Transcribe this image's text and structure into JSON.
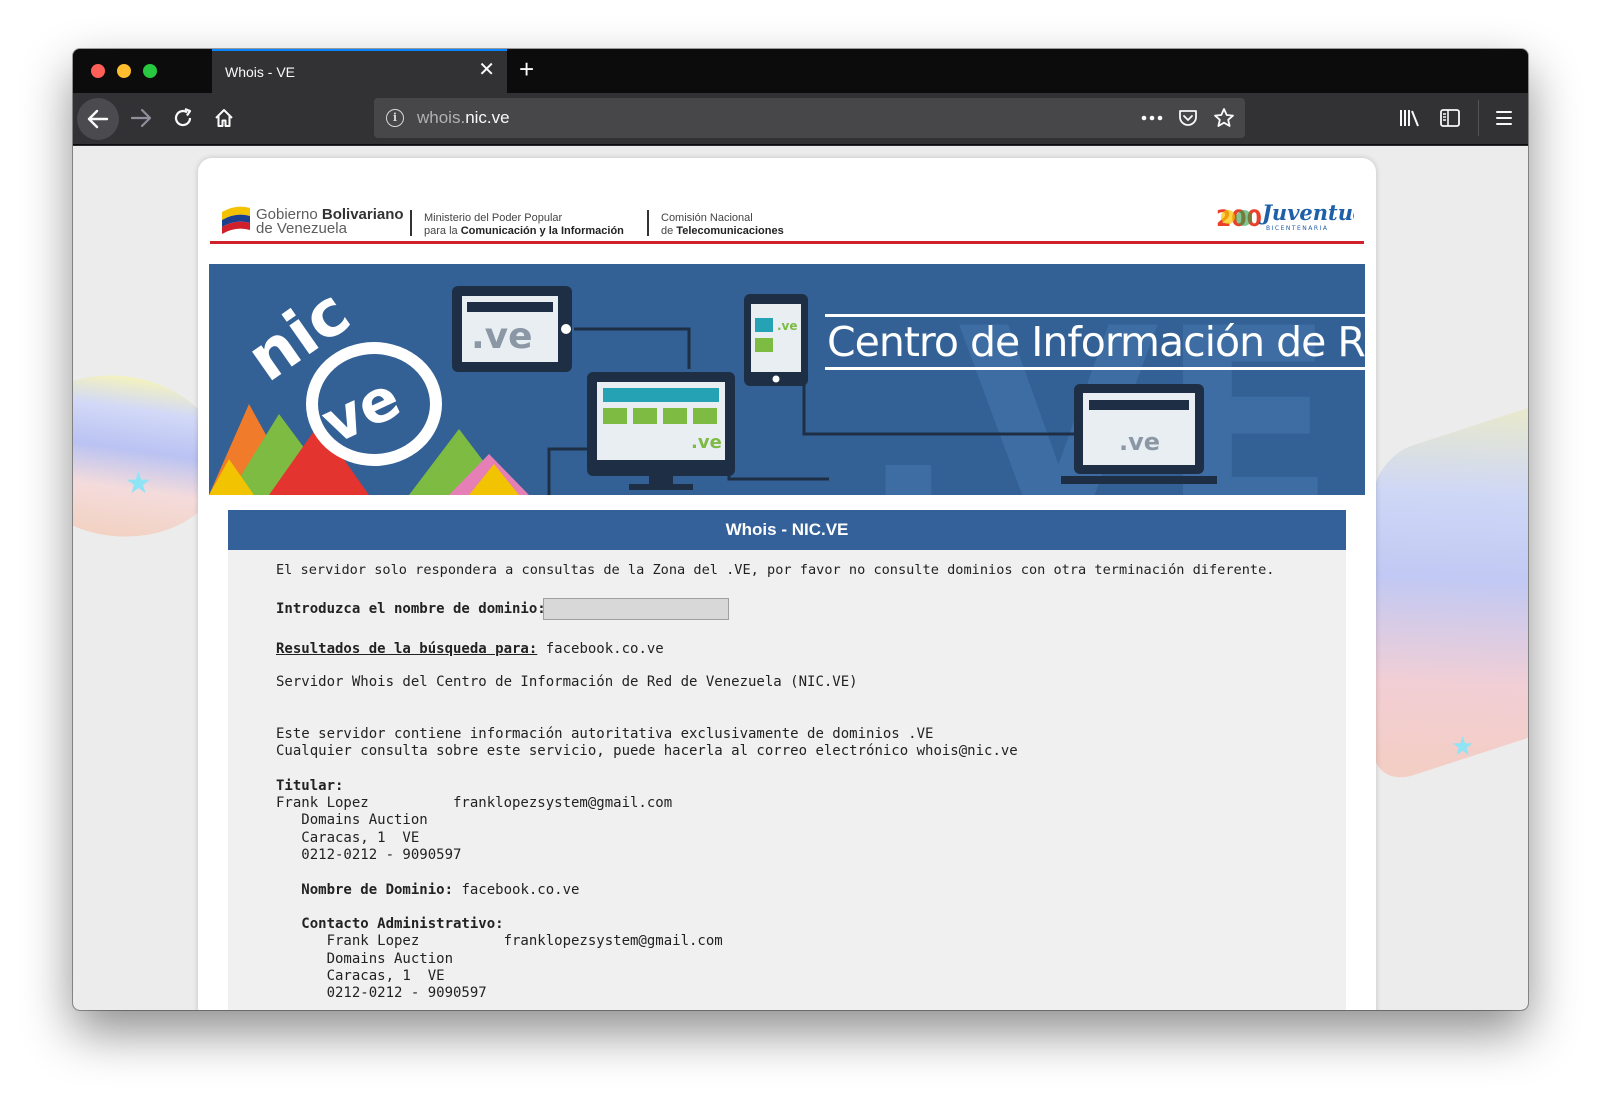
{
  "browser": {
    "tab_title": "Whois - VE",
    "url_prefix": "whois.",
    "url_host": "nic.ve"
  },
  "header": {
    "gov_line1_light": "Gobierno ",
    "gov_line1_bold": "Bolivariano",
    "gov_line2": "de Venezuela",
    "ministry_line1": "Ministerio del Poder Popular",
    "ministry_line2_light": "para la ",
    "ministry_line2_bold": "Comunicación y la Información",
    "conatel_line1": "Comisión Nacional",
    "conatel_line2_light": "de ",
    "conatel_line2_bold": "Telecomunicaciones",
    "juventud_logo_text": "Juventud",
    "juventud_sub": "BICENTENARIA",
    "juventud_number": "200"
  },
  "banner": {
    "title": "Centro de Información de Red",
    "logo_top": "nic",
    "logo_bottom": "ve",
    "screen_label": ".ve",
    "watermark": ".VE"
  },
  "whois": {
    "panel_title": "Whois - NIC.VE",
    "notice": "El servidor solo respondera a consultas de la Zona del .VE, por favor no consulte dominios con otra terminación diferente.",
    "input_label": "Introduzca el nombre de dominio:",
    "input_value": "",
    "results_label": "Resultados de la búsqueda para:",
    "results_domain": " facebook.co.ve",
    "server_line": "Servidor Whois del Centro de Información de Red de Venezuela (NIC.VE)",
    "info_line1": "Este servidor contiene información autoritativa exclusivamente de dominios .VE",
    "info_line2": "Cualquier consulta sobre este servicio, puede hacerla al correo electrónico whois@nic.ve",
    "titular_label": "Titular:",
    "titular_name": "Frank Lopez          franklopezsystem@gmail.com",
    "titular_org": "   Domains Auction",
    "titular_city": "   Caracas, 1  VE",
    "titular_phone": "   0212-0212 - 9090597",
    "domain_label": "   Nombre de Dominio:",
    "domain_value": " facebook.co.ve",
    "admin_label": "   Contacto Administrativo:",
    "admin_name": "      Frank Lopez          franklopezsystem@gmail.com",
    "admin_org": "      Domains Auction",
    "admin_city": "      Caracas, 1  VE",
    "admin_phone": "      0212-0212 - 9090597"
  }
}
